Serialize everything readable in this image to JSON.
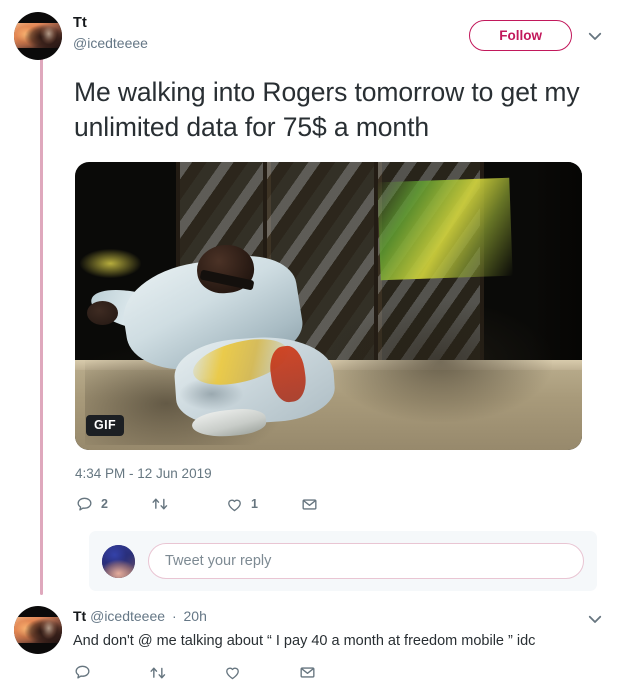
{
  "theme": {
    "accent_pink": "#c2185b",
    "thread_line": "#dfa8bd",
    "icon_gray": "#66757f",
    "text_dark": "#292f33",
    "text_muted": "#657786",
    "composer_bg": "#f5f8fa",
    "input_border": "#e9c5d3"
  },
  "tweet": {
    "display_name": "Tt",
    "handle": "@icedteeee",
    "follow_label": "Follow",
    "caret_icon": "chevron-down-icon",
    "text": "Me walking into Rogers tomorrow to get my unlimited data for 75$ a month",
    "media": {
      "type": "gif",
      "badge_label": "GIF",
      "alt": "man in light blue tracksuit dancing in front of a wooden fence"
    },
    "timestamp": "4:34 PM - 12 Jun 2019",
    "actions": [
      {
        "name": "reply",
        "icon": "reply-icon",
        "count": "2"
      },
      {
        "name": "retweet",
        "icon": "retweet-icon",
        "count": ""
      },
      {
        "name": "like",
        "icon": "heart-icon",
        "count": "1"
      },
      {
        "name": "share",
        "icon": "envelope-icon",
        "count": ""
      }
    ]
  },
  "composer": {
    "placeholder": "Tweet your reply",
    "value": "",
    "avatar": "user-avatar"
  },
  "reply": {
    "display_name": "Tt",
    "handle": "@icedteeee",
    "separator": "·",
    "time_ago": "20h",
    "text": "And don't @ me talking about “ I pay 40 a month at freedom mobile ”  idc",
    "caret_icon": "chevron-down-icon",
    "actions": [
      {
        "name": "reply",
        "icon": "reply-icon",
        "count": ""
      },
      {
        "name": "retweet",
        "icon": "retweet-icon",
        "count": ""
      },
      {
        "name": "like",
        "icon": "heart-icon",
        "count": ""
      },
      {
        "name": "share",
        "icon": "envelope-icon",
        "count": ""
      }
    ]
  }
}
